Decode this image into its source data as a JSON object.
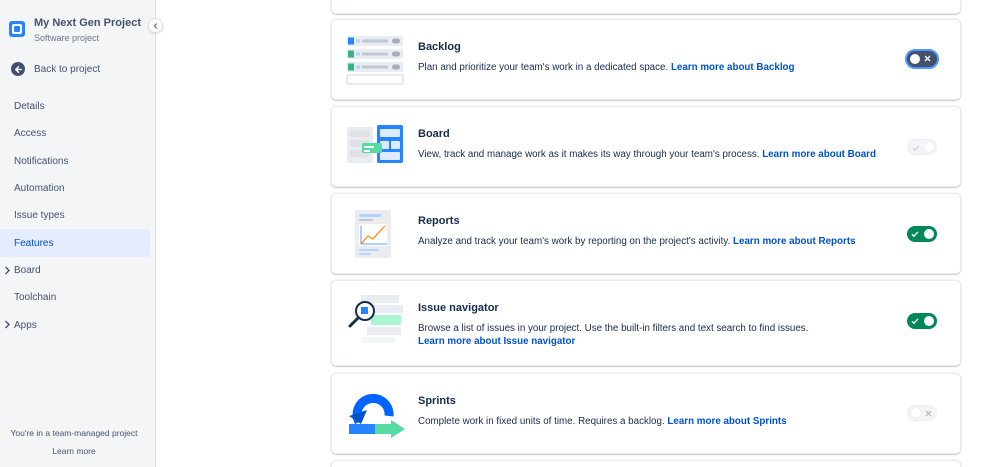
{
  "project": {
    "name": "My Next Gen Project",
    "type": "Software project"
  },
  "nav": {
    "back_label": "Back to project",
    "items": [
      {
        "label": "Details"
      },
      {
        "label": "Access"
      },
      {
        "label": "Notifications"
      },
      {
        "label": "Automation"
      },
      {
        "label": "Issue types"
      },
      {
        "label": "Features",
        "active": true
      },
      {
        "label": "Board",
        "expandable": true
      },
      {
        "label": "Toolchain"
      },
      {
        "label": "Apps",
        "expandable": true
      }
    ]
  },
  "footer": {
    "text": "You're in a team-managed project",
    "link": "Learn more"
  },
  "features": [
    {
      "title": "Backlog",
      "description": "Plan and prioritize your team's work in a dedicated space.",
      "link": "Learn more about Backlog",
      "toggle": "off",
      "focused": true,
      "disabled": false
    },
    {
      "title": "Board",
      "description": "View, track and manage work as it makes its way through your team's process.",
      "link": "Learn more about Board",
      "toggle": "on",
      "disabled": true
    },
    {
      "title": "Reports",
      "description": "Analyze and track your team's work by reporting on the project's activity.",
      "link": "Learn more about Reports",
      "toggle": "on",
      "disabled": false
    },
    {
      "title": "Issue navigator",
      "description": "Browse a list of issues in your project. Use the built-in filters and text search to find issues.",
      "link": "Learn more about Issue navigator",
      "toggle": "on",
      "disabled": false
    },
    {
      "title": "Sprints",
      "description": "Complete work in fixed units of time. Requires a backlog.",
      "link": "Learn more about Sprints",
      "toggle": "off",
      "disabled": true
    }
  ],
  "colors": {
    "accent": "#0052cc",
    "toggle_on": "#00875a",
    "toggle_off": "#42526e",
    "sidebar_bg": "#f4f5f7",
    "active_bg": "#e5ecfb"
  },
  "icons": {
    "back": "arrow-left-icon",
    "collapse": "chevron-left-icon",
    "expand": "chevron-right-icon",
    "check": "check-icon",
    "cross": "cross-icon"
  }
}
